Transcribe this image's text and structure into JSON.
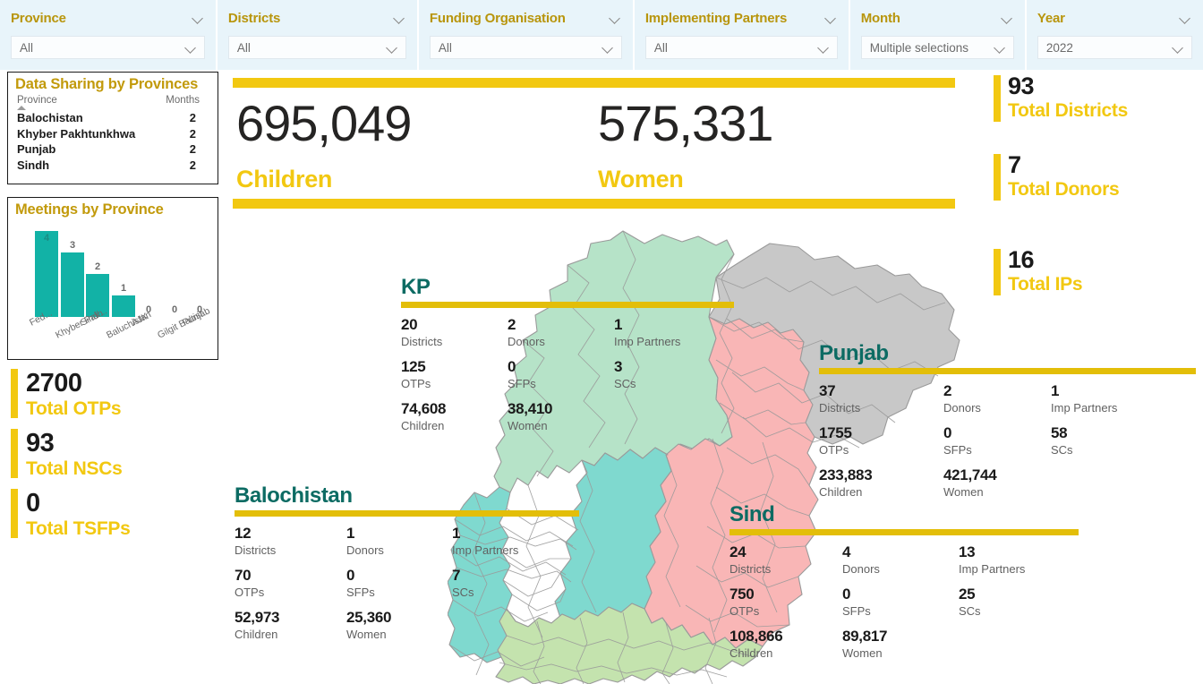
{
  "filters": [
    {
      "title": "Province",
      "value": "All"
    },
    {
      "title": "Districts",
      "value": "All"
    },
    {
      "title": "Funding Organisation",
      "value": "All"
    },
    {
      "title": "Implementing Partners",
      "value": "All"
    },
    {
      "title": "Month",
      "value": "Multiple selections"
    },
    {
      "title": "Year",
      "value": "2022"
    }
  ],
  "data_sharing": {
    "title": "Data Sharing by Provinces",
    "col_province": "Province",
    "col_months": "Months",
    "rows": [
      {
        "province": "Balochistan",
        "months": "2"
      },
      {
        "province": "Khyber Pakhtunkhwa",
        "months": "2"
      },
      {
        "province": "Punjab",
        "months": "2"
      },
      {
        "province": "Sindh",
        "months": "2"
      }
    ]
  },
  "meetings": {
    "title": "Meetings by Province"
  },
  "chart_data": {
    "type": "bar",
    "title": "Meetings by Province",
    "categories": [
      "Fed...",
      "Khyber Pak...",
      "Sindh",
      "Baluchistan",
      "AJK",
      "Gilgit Baltist...",
      "Punjab"
    ],
    "values": [
      4,
      3,
      2,
      1,
      0,
      0,
      0
    ],
    "data_labels": [
      "4",
      "3",
      "2",
      "1",
      "0",
      "0",
      "0"
    ],
    "xlabel": "",
    "ylabel": "",
    "ylim": [
      0,
      4
    ],
    "grid": false,
    "legend": "none",
    "series_color": "#12B2A6"
  },
  "hero": {
    "children_value": "695,049",
    "children_label": "Children",
    "women_value": "575,331",
    "women_label": "Women"
  },
  "left_kpis": [
    {
      "num": "2700",
      "label": "Total OTPs"
    },
    {
      "num": "93",
      "label": "Total NSCs"
    },
    {
      "num": "0",
      "label": "Total TSFPs"
    }
  ],
  "right_kpis": [
    {
      "num": "93",
      "label": "Total Districts"
    },
    {
      "num": "7",
      "label": "Total Donors"
    },
    {
      "num": "16",
      "label": "Total IPs"
    }
  ],
  "provinces": {
    "kp": {
      "name": "KP",
      "cells": [
        {
          "num": "20",
          "label": "Districts"
        },
        {
          "num": "2",
          "label": "Donors"
        },
        {
          "num": "1",
          "label": "Imp Partners"
        },
        {
          "num": "125",
          "label": "OTPs"
        },
        {
          "num": "0",
          "label": "SFPs"
        },
        {
          "num": "3",
          "label": "SCs"
        },
        {
          "num": "74,608",
          "label": "Children"
        },
        {
          "num": "38,410",
          "label": "Women"
        }
      ]
    },
    "punjab": {
      "name": "Punjab",
      "cells": [
        {
          "num": "37",
          "label": "Districts"
        },
        {
          "num": "2",
          "label": "Donors"
        },
        {
          "num": "1",
          "label": "Imp Partners"
        },
        {
          "num": "1755",
          "label": "OTPs"
        },
        {
          "num": "0",
          "label": "SFPs"
        },
        {
          "num": "58",
          "label": "SCs"
        },
        {
          "num": "233,883",
          "label": "Children"
        },
        {
          "num": "421,744",
          "label": "Women"
        }
      ]
    },
    "balochistan": {
      "name": "Balochistan",
      "cells": [
        {
          "num": "12",
          "label": "Districts"
        },
        {
          "num": "1",
          "label": "Donors"
        },
        {
          "num": "1",
          "label": "Imp Partners"
        },
        {
          "num": "70",
          "label": "OTPs"
        },
        {
          "num": "0",
          "label": "SFPs"
        },
        {
          "num": "7",
          "label": "SCs"
        },
        {
          "num": "52,973",
          "label": "Children"
        },
        {
          "num": "25,360",
          "label": "Women"
        }
      ]
    },
    "sind": {
      "name": "Sind",
      "cells": [
        {
          "num": "24",
          "label": "Districts"
        },
        {
          "num": "4",
          "label": "Donors"
        },
        {
          "num": "13",
          "label": "Imp Partners"
        },
        {
          "num": "750",
          "label": "OTPs"
        },
        {
          "num": "0",
          "label": "SFPs"
        },
        {
          "num": "25",
          "label": "SCs"
        },
        {
          "num": "108,866",
          "label": "Children"
        },
        {
          "num": "89,817",
          "label": "Women"
        }
      ]
    }
  },
  "map": {
    "colors": {
      "kp": "#B6E3C8",
      "punjab": "#F9B6B6",
      "balochistan": "#7FD9CF",
      "sindh": "#C4E3AE",
      "disputed": "#C8C8C8",
      "border": "#9a9a9a",
      "accent_yellow": "#F2C811",
      "heading_teal": "#0C6B63"
    }
  }
}
